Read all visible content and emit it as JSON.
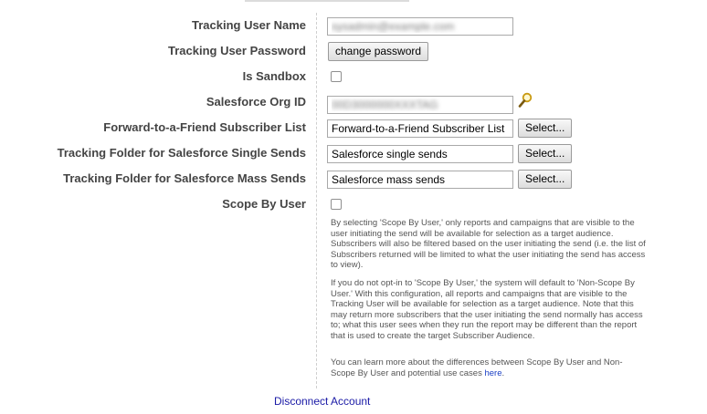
{
  "form": {
    "tracking_user_name": {
      "label": "Tracking User Name",
      "value": "sysadmin@example.com"
    },
    "tracking_user_password": {
      "label": "Tracking User Password",
      "button": "change password"
    },
    "is_sandbox": {
      "label": "Is Sandbox",
      "checked": false
    },
    "salesforce_org_id": {
      "label": "Salesforce Org ID",
      "value": "00D3000000XXXTAG"
    },
    "forward_to_friend_list": {
      "label": "Forward-to-a-Friend Subscriber List",
      "value": "Forward-to-a-Friend Subscriber List",
      "button": "Select..."
    },
    "single_sends_folder": {
      "label": "Tracking Folder for Salesforce Single Sends",
      "value": "Salesforce single sends",
      "button": "Select..."
    },
    "mass_sends_folder": {
      "label": "Tracking Folder for Salesforce Mass Sends",
      "value": "Salesforce mass sends",
      "button": "Select..."
    },
    "scope_by_user": {
      "label": "Scope By User",
      "checked": false
    }
  },
  "help": {
    "p1": "By selecting 'Scope By User,' only reports and campaigns that are visible to the user initiating the send will be available for selection as a target audience. Subscribers will also be filtered based on the user initiating the send (i.e. the list of Subscribers returned will be limited to what the user initiating the send has access to view).",
    "p2": "If you do not opt-in to 'Scope By User,' the system will default to 'Non-Scope By User.' With this configuration, all reports and campaigns that are visible to the Tracking User will be available for selection as a target audience. Note that this may return more subscribers that the user initiating the send normally has access to; what this user sees when they run the report may be different than the report that is used to create the target Subscriber Audience.",
    "p3_before": "You can learn more about the differences between Scope By User and Non-Scope By User and potential use cases ",
    "p3_link": "here",
    "p3_after": "."
  },
  "footer": {
    "disconnect": "Disconnect Account"
  },
  "icons": {
    "lookup": "magnifier-icon"
  },
  "colors": {
    "link": "#1a1aa6",
    "label": "#444444"
  }
}
